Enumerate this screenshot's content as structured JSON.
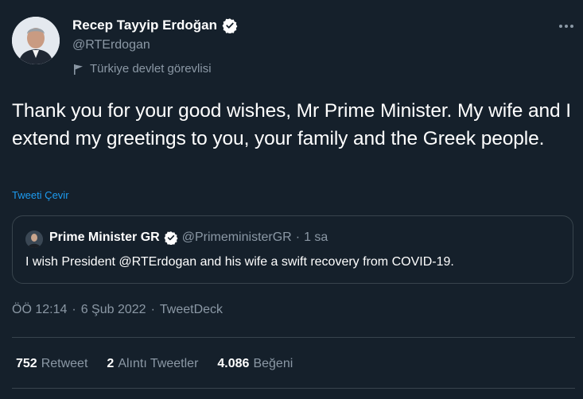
{
  "author": {
    "name": "Recep Tayyip Erdoğan",
    "handle": "@RTErdogan",
    "label": "Türkiye devlet görevlisi"
  },
  "tweet": {
    "text": "Thank you for your good wishes, Mr Prime Minister. My wife and I extend my greetings to you, your family and the Greek people.",
    "translate_label": "Tweeti Çevir"
  },
  "quoted": {
    "name": "Prime Minister GR",
    "handle": "@PrimeministerGR",
    "separator": "·",
    "time": "1 sa",
    "text": "I wish President @RTErdogan and his wife a swift recovery from COVID-19."
  },
  "meta": {
    "time": "ÖÖ 12:14",
    "sep1": "·",
    "date": "6 Şub 2022",
    "sep2": "·",
    "source": "TweetDeck"
  },
  "stats": {
    "retweets_count": "752",
    "retweets_label": "Retweet",
    "quotes_count": "2",
    "quotes_label": "Alıntı Tweetler",
    "likes_count": "4.086",
    "likes_label": "Beğeni"
  },
  "colors": {
    "background": "#15202b",
    "secondary_text": "#8b98a5",
    "link": "#1d9bf0",
    "border": "#38444d",
    "verified_badge": "#ffffff"
  },
  "icons": {
    "verified": "verified-badge-icon",
    "label": "flag-icon",
    "more": "more-icon"
  }
}
